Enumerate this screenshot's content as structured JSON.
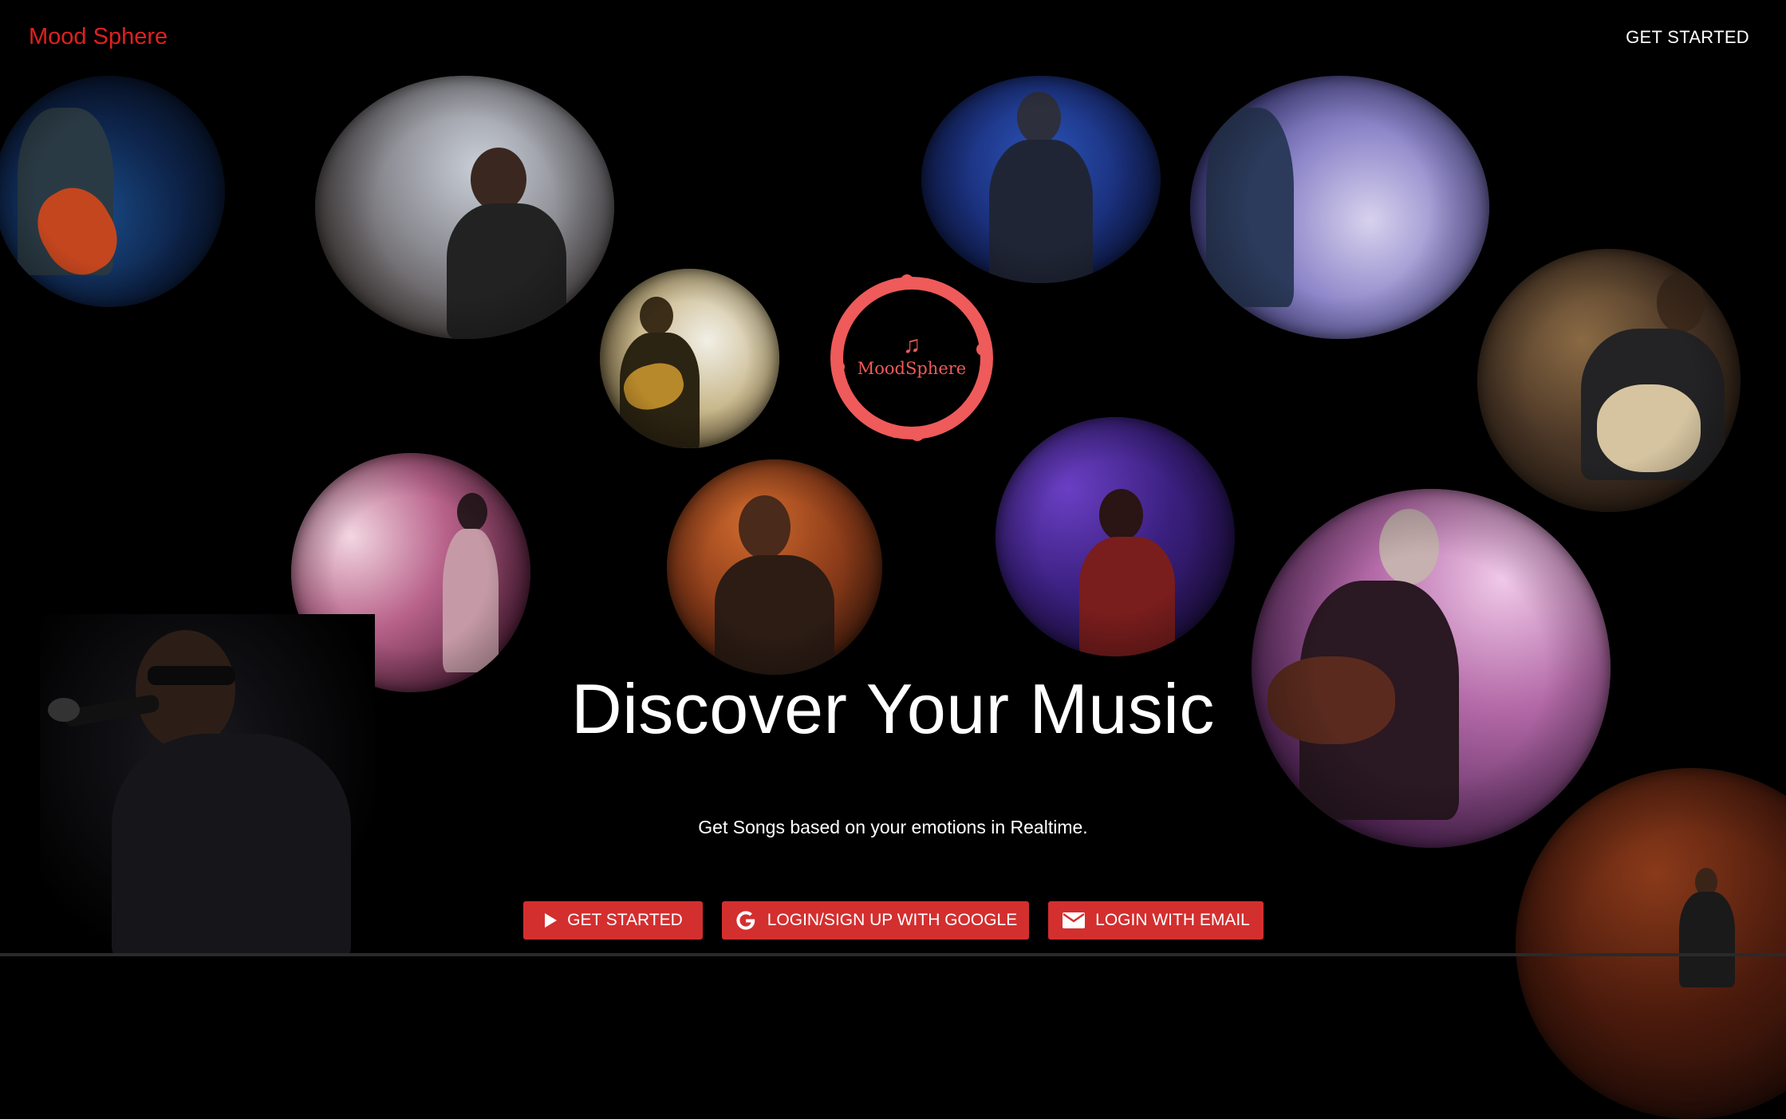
{
  "header": {
    "brand": "Mood Sphere",
    "get_started": "GET STARTED"
  },
  "logo": {
    "text": "MoodSphere",
    "icon": "music-note-icon",
    "color": "#ef5a5a"
  },
  "hero": {
    "headline": "Discover Your Music",
    "tagline": "Get Songs based on your emotions in Realtime."
  },
  "actions": {
    "get_started": "GET STARTED",
    "google": "LOGIN/SIGN UP WITH GOOGLE",
    "email": "LOGIN WITH EMAIL"
  },
  "colors": {
    "brand": "#e02020",
    "button": "#d32f2f",
    "background": "#000000"
  }
}
